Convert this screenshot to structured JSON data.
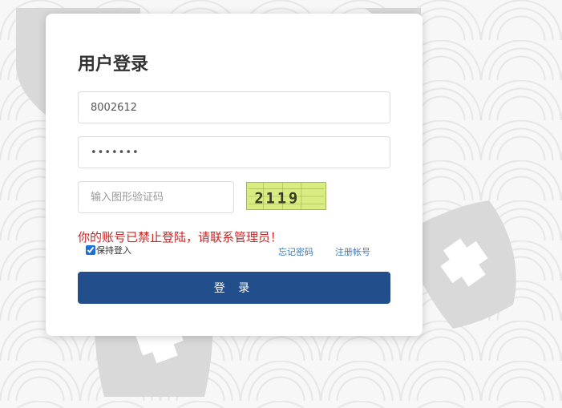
{
  "login": {
    "title": "用户登录",
    "account_value": "8002612",
    "password_value": "•••••••",
    "captcha_placeholder": "输入图形验证码",
    "captcha_text": "2119",
    "error_message": "你的账号已禁止登陆，请联系管理员！",
    "remember_label": "保持登入",
    "remember_checked": true,
    "forgot_link": "忘记密码",
    "register_link": "注册帐号",
    "submit_label": "登 录"
  },
  "colors": {
    "primary_button": "#234e8c",
    "error_text": "#cc2222",
    "link": "#3a78b8",
    "captcha_bg": "#d9ec82"
  },
  "decorations": [
    "shield-cross-watermark"
  ]
}
